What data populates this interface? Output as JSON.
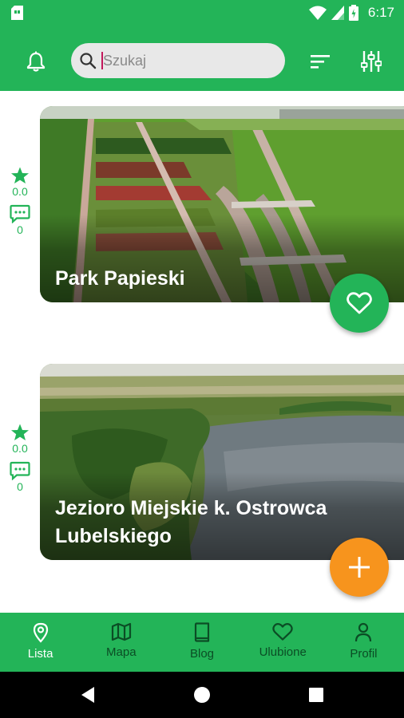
{
  "status_bar": {
    "time": "6:17",
    "icons": [
      "sim-card-icon",
      "wifi-icon",
      "signal-icon",
      "battery-icon"
    ]
  },
  "app_bar": {
    "notifications_icon": "bell-icon",
    "search": {
      "placeholder": "Szukaj",
      "value": "",
      "icon": "search-icon"
    },
    "sort_icon": "sort-icon",
    "filter_icon": "sliders-icon"
  },
  "places": [
    {
      "name": "Park Papieski",
      "rating": "0.0",
      "comments": "0",
      "favorite_icon": "heart-outline-icon"
    },
    {
      "name": "Jezioro Miejskie k. Ostrowca Lubelskiego",
      "rating": "0.0",
      "comments": "0"
    }
  ],
  "add_button_icon": "plus-icon",
  "bottom_nav": {
    "items": [
      {
        "label": "Lista",
        "icon": "map-pin-icon",
        "active": true
      },
      {
        "label": "Mapa",
        "icon": "map-icon",
        "active": false
      },
      {
        "label": "Blog",
        "icon": "book-icon",
        "active": false
      },
      {
        "label": "Ulubione",
        "icon": "heart-icon",
        "active": false
      },
      {
        "label": "Profil",
        "icon": "person-icon",
        "active": false
      }
    ]
  },
  "system_nav": [
    "back-icon",
    "home-icon",
    "recents-icon"
  ],
  "colors": {
    "primary": "#23b458",
    "nav_inactive": "#0b4d25",
    "fab_add": "#f7941d",
    "fab_favorite": "#23b458"
  }
}
